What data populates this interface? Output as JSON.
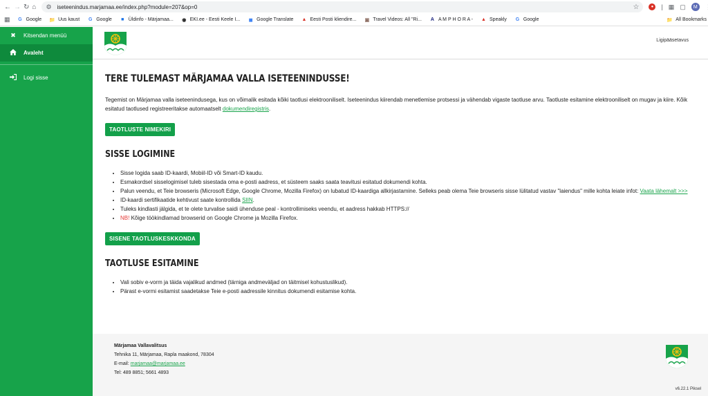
{
  "browser": {
    "url": "iseteenindus.marjamaa.ee/index.php?module=207&op=0",
    "profile_initial": "M",
    "bookmarks": [
      {
        "label": "Google",
        "icon": "google-icon"
      },
      {
        "label": "Uus kaust",
        "icon": "folder-icon"
      },
      {
        "label": "Google",
        "icon": "google-icon"
      },
      {
        "label": "Üldinfo - Märjamaa...",
        "icon": "site-icon"
      },
      {
        "label": "EKI.ee - Eesti Keele I...",
        "icon": "eki-icon"
      },
      {
        "label": "Google Translate",
        "icon": "translate-icon"
      },
      {
        "label": "Eesti Posti kliendire...",
        "icon": "posti-icon"
      },
      {
        "label": "Travel Videos: All \"Ri...",
        "icon": "travel-icon"
      },
      {
        "label": "A M P H O R A -",
        "icon": "amphora-icon"
      },
      {
        "label": "Speakly",
        "icon": "speakly-icon"
      },
      {
        "label": "Google",
        "icon": "google-icon"
      }
    ],
    "all_bookmarks": "All Bookmarks"
  },
  "sidebar": {
    "collapse_label": "Kitsendan menüü",
    "home_label": "Avaleht",
    "login_label": "Logi sisse"
  },
  "header": {
    "accessibility_label": "Ligipääsetavus"
  },
  "main": {
    "welcome_title": "TERE TULEMAST MÄRJAMAA VALLA ISETEENINDUSSE!",
    "intro_text": "Tegemist on Märjamaa valla iseteenindusega, kus on võimalik esitada kõiki taotlusi elektrooniliselt. Iseteenindus kiirendab menetlemise protsessi ja vähendab vigaste taotluse arvu. Taotluste esitamine elektrooniliselt on mugav ja kiire. Kõik esitatud taotlused registreeritakse automaatselt ",
    "intro_link": "dokumendiregistris",
    "intro_end": ".",
    "applications_button": "TAOTLUSTE NIMEKIRI",
    "login_title": "SISSE LOGIMINE",
    "login_items": {
      "i1": "Sisse logida saab ID-kaardi, Mobiil-ID või Smart-ID kaudu.",
      "i2": "Esmakordsel sisselogimisel tuleb sisestada oma e-posti aadress, et süsteem saaks saata teavitusi esitatud dokumendi kohta.",
      "i3": "Palun veendu, et Teie browseris (Microsoft Edge, Google Chrome,  Mozilla Firefox) on lubatud ID-kaardiga allkirjastamine. Selleks peab olema Teie browseris sisse lülitatud vastav \"laiendus\" mille kohta leiate infot: ",
      "i3_link": "Vaata lähemalt >>>",
      "i4": "ID-kaardi sertifikaatide kehtivust saate kontrollida ",
      "i4_link": "SIIN",
      "i4_end": ".",
      "i5": "Tuleks kindlasti jälgida, et te olete turvalise saidi ühenduse peal - kontrollimiseks veendu, et aadress hakkab HTTPS://",
      "i6_nb": "NB!",
      "i6": " Kõige töökindlamad browserid on Google Chrome ja Mozilla Firefox."
    },
    "center_button": "SISENE TAOTLUSKESKKONDA",
    "submission_title": "TAOTLUSE ESITAMINE",
    "submission_items": {
      "i1": "Vali sobiv e-vorm ja täida vajalikud andmed (tärniga andmeväljad on täitmisel kohustuslikud).",
      "i2": "Pärast e-vormi esitamist saadetakse Teie e-posti aadressile kinnitus dokumendi esitamise kohta."
    }
  },
  "footer": {
    "org_name": "Märjamaa Vallavalitsus",
    "address": "Tehnika 11, Märjamaa, Rapla maakond, 78304",
    "email_label": "E-mail: ",
    "email": "marjamaa@marjamaa.ee",
    "phone": "Tel: 489 8851; 5661 4893",
    "version": "v6.22.1 Piksel"
  },
  "colors": {
    "brand_green": "#17a34a",
    "active_green": "#0e8a3c",
    "nb_red": "#e53935"
  }
}
